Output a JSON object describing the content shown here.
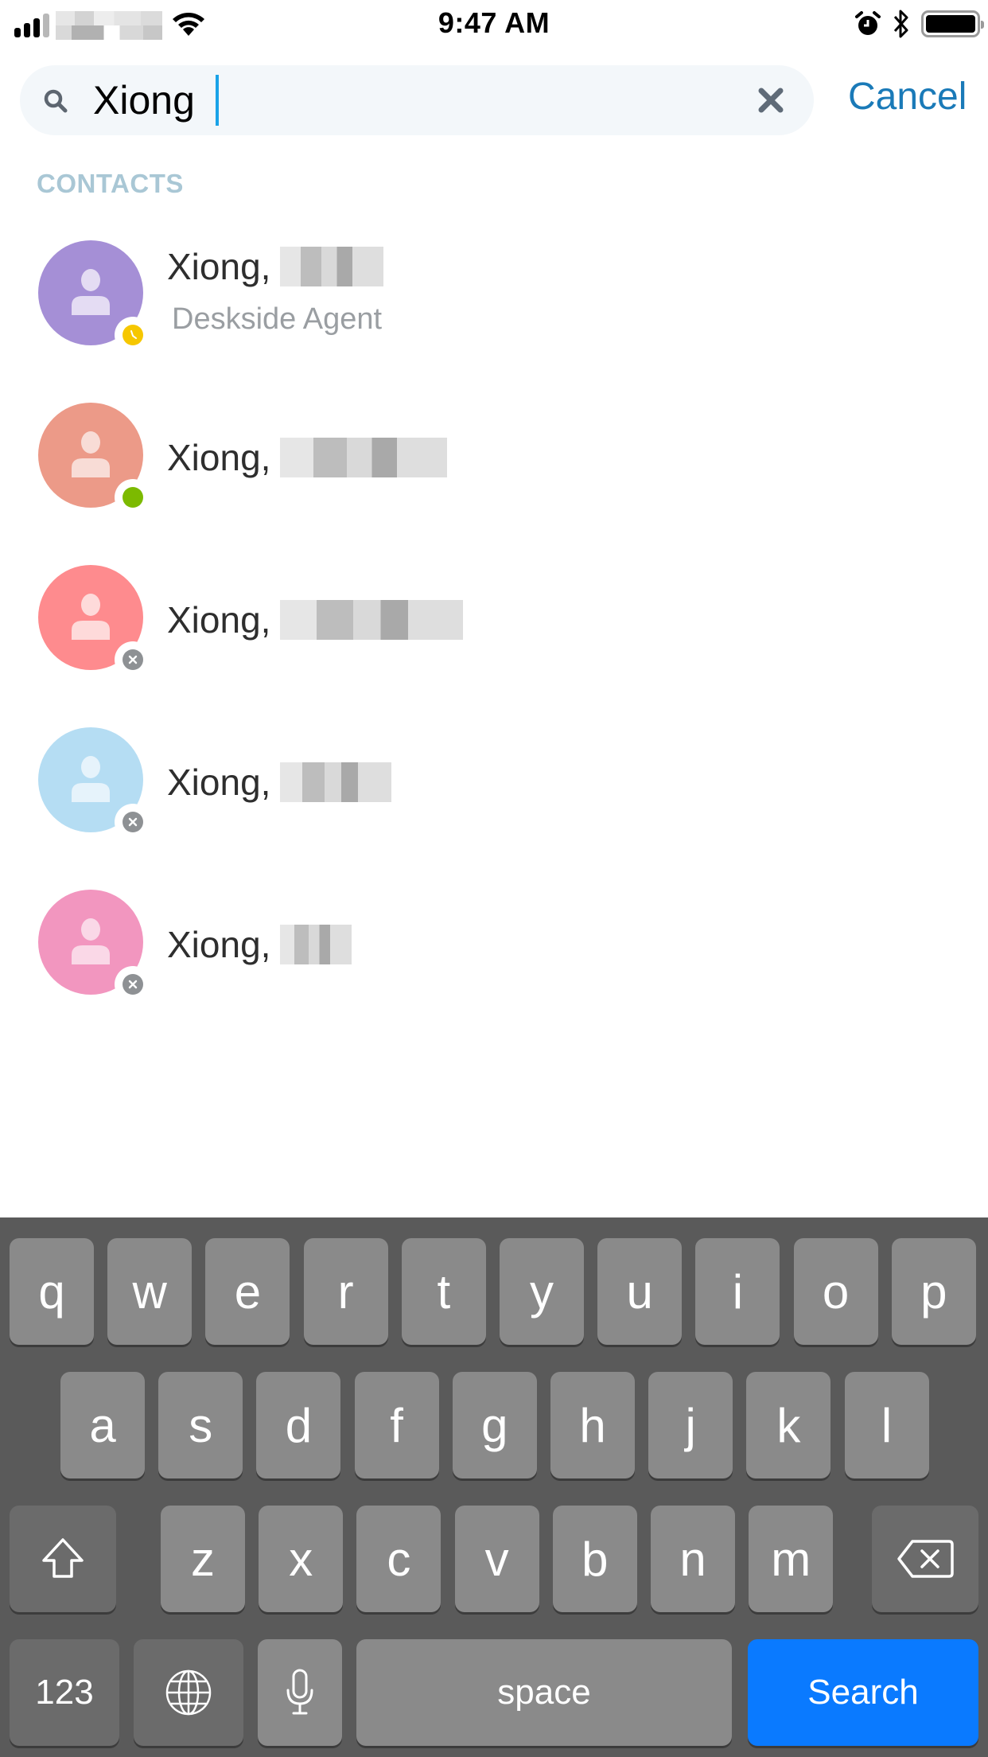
{
  "status_bar": {
    "time": "9:47 AM",
    "signal_bars": 4,
    "signal_bars_active": 3,
    "icons": [
      "signal-icon",
      "wifi-icon",
      "alarm-icon",
      "bluetooth-icon",
      "battery-icon"
    ],
    "battery_level": 1.0
  },
  "search": {
    "value": "Xiong",
    "clear_icon": "close-icon",
    "search_icon": "search-icon",
    "cancel_label": "Cancel"
  },
  "section": {
    "contacts_header": "CONTACTS"
  },
  "contacts": [
    {
      "name": "Xiong,",
      "subtitle": "Deskside Agent",
      "avatar_color": "#a58fd6",
      "avatar_icon_color": "#e4dcf3",
      "presence": "away",
      "presence_color": "#f6c700"
    },
    {
      "name": "Xiong,",
      "subtitle": "",
      "avatar_color": "#ec9a88",
      "avatar_icon_color": "#f8dcd6",
      "presence": "available",
      "presence_color": "#7cba00"
    },
    {
      "name": "Xiong,",
      "subtitle": "",
      "avatar_color": "#fe8b8e",
      "avatar_icon_color": "#fedada",
      "presence": "offline",
      "presence_color": "#8e9194"
    },
    {
      "name": "Xiong,",
      "subtitle": "",
      "avatar_color": "#b5ddf3",
      "avatar_icon_color": "#e6f3fb",
      "presence": "offline",
      "presence_color": "#8e9194"
    },
    {
      "name": "Xiong,",
      "subtitle": "",
      "avatar_color": "#f296bf",
      "avatar_icon_color": "#fad8e7",
      "presence": "offline",
      "presence_color": "#8e9194"
    }
  ],
  "keyboard": {
    "row1": [
      "q",
      "w",
      "e",
      "r",
      "t",
      "y",
      "u",
      "i",
      "o",
      "p"
    ],
    "row2": [
      "a",
      "s",
      "d",
      "f",
      "g",
      "h",
      "j",
      "k",
      "l"
    ],
    "row3": [
      "z",
      "x",
      "c",
      "v",
      "b",
      "n",
      "m"
    ],
    "shift_icon": "shift-icon",
    "delete_icon": "backspace-icon",
    "numbers_label": "123",
    "globe_icon": "globe-icon",
    "mic_icon": "microphone-icon",
    "space_label": "space",
    "return_label": "Search",
    "return_color": "#0a7aff"
  }
}
